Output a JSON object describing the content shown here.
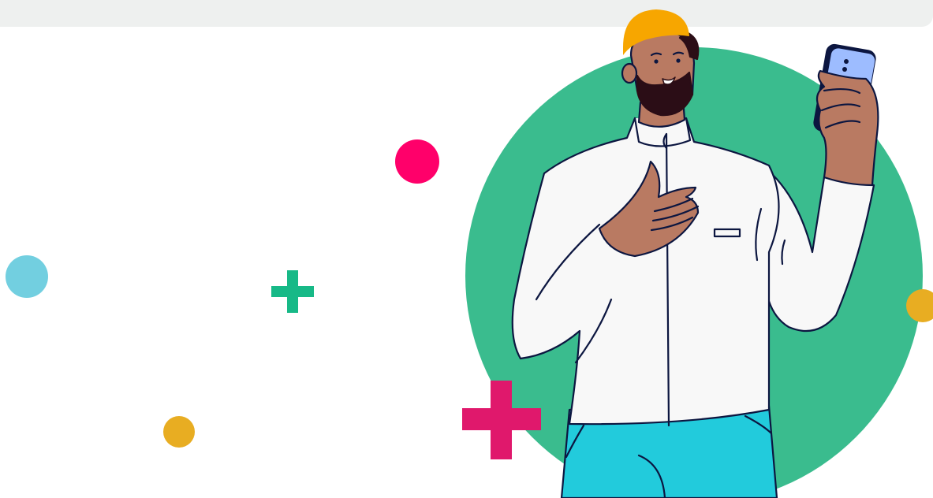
{
  "scene": {
    "subject": "worker-with-phone-illustration",
    "colors": {
      "background": "#ffffff",
      "top_band": "#eef0ef",
      "circle_green": "#3abc8e",
      "dot_pink": "#ff006a",
      "dot_blue": "#72cfe0",
      "dot_yellow": "#e8ad22",
      "plus_green": "#17b987",
      "plus_magenta": "#e0186c",
      "helmet": "#f7a600",
      "skin": "#b97a62",
      "beard": "#2b0d16",
      "jacket": "#f8f8f8",
      "pants": "#22cbdc",
      "phone": "#9dbcff",
      "outline": "#0c1640"
    },
    "icons": [
      "pink-dot-icon",
      "blue-dot-icon",
      "yellow-dot-icon",
      "green-plus-icon",
      "magenta-plus-icon",
      "worker-illustration"
    ]
  }
}
